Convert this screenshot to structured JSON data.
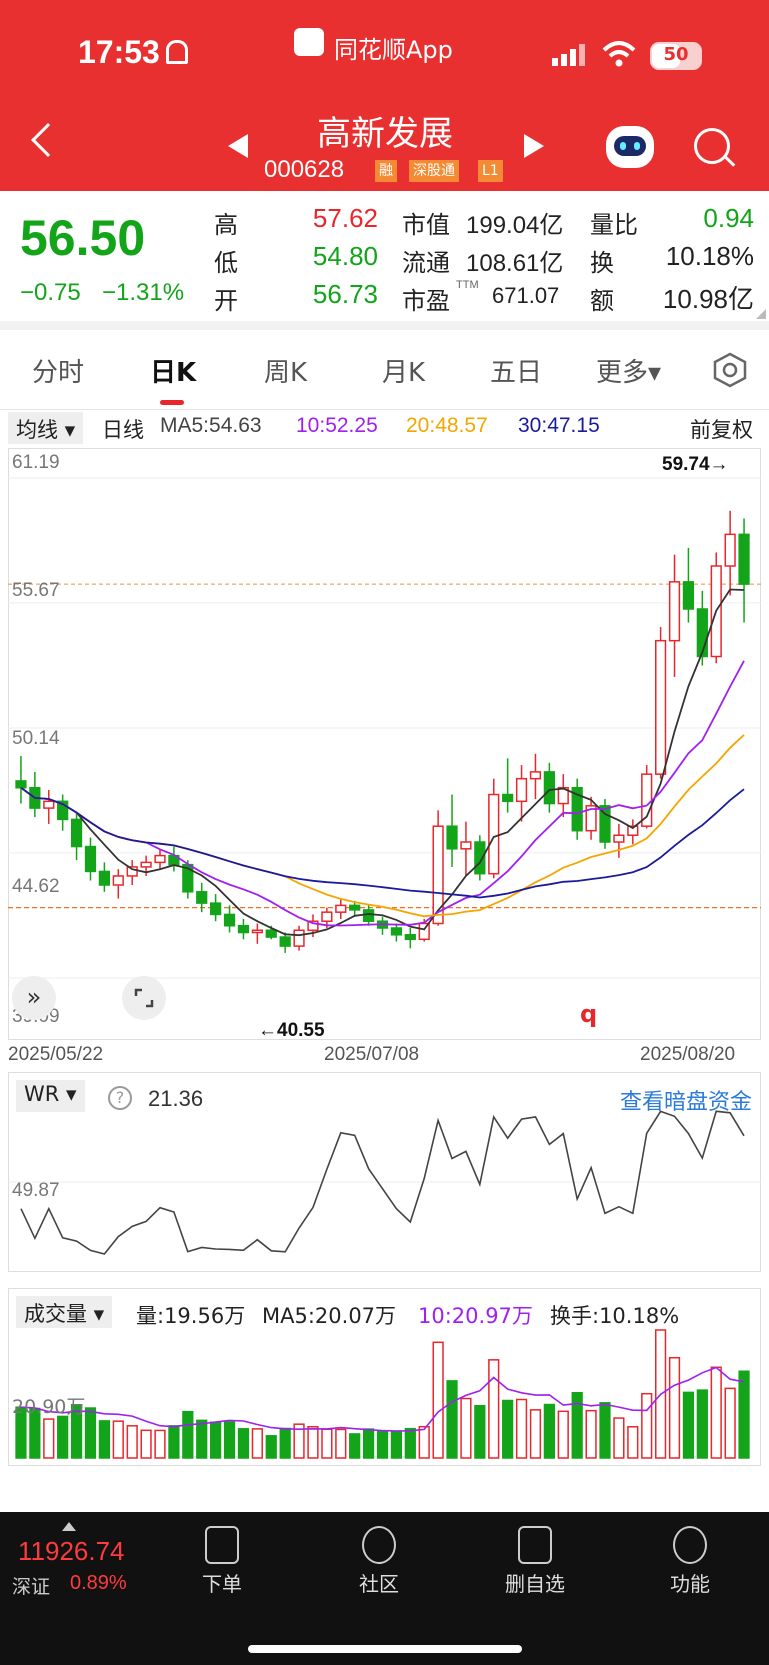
{
  "status_bar": {
    "time": "17:53",
    "app_name": "同花顺App",
    "battery": "50"
  },
  "header": {
    "title": "高新发展",
    "code": "000628",
    "badges": [
      "融",
      "深股通",
      "L1"
    ]
  },
  "quote": {
    "price": "56.50",
    "change": "−0.75",
    "change_pct": "−1.31%",
    "high_label": "高",
    "high": "57.62",
    "low_label": "低",
    "low": "54.80",
    "open_label": "开",
    "open": "56.73",
    "mcap_label": "市值",
    "mcap": "199.04亿",
    "float_label": "流通",
    "float": "108.61亿",
    "pe_label": "市盈",
    "pe_sup": "TTM",
    "pe": "671.07",
    "vr_label": "量比",
    "vr": "0.94",
    "turnover_label": "换",
    "turnover": "10.18%",
    "amount_label": "额",
    "amount": "10.98亿"
  },
  "tabs": [
    "分时",
    "日K",
    "周K",
    "月K",
    "五日",
    "更多▾"
  ],
  "active_tab": "日K",
  "ma_bar": {
    "selector": "均线 ▾",
    "period": "日线",
    "ma5": "MA5:54.63",
    "ma10": "10:52.25",
    "ma20": "20:48.57",
    "ma30": "30:47.15",
    "adjust": "前复权"
  },
  "kline": {
    "y_ticks": [
      "61.19",
      "55.67",
      "50.14",
      "44.62",
      "39.09"
    ],
    "max_label": "59.74→",
    "min_label": "←40.55",
    "x_dates": [
      "2025/05/22",
      "2025/07/08",
      "2025/08/20"
    ],
    "q_marker": "q"
  },
  "wr": {
    "selector": "WR ▾",
    "help": "?",
    "value": "21.36",
    "mid_tick": "49.87",
    "link": "查看暗盘资金"
  },
  "volume": {
    "selector": "成交量 ▾",
    "vol": "量:19.56万",
    "ma5": "MA5:20.07万",
    "ma10": "10:20.97万",
    "turnover": "换手:10.18%",
    "tick": "20.90万"
  },
  "bottom": {
    "index_value": "11926.74",
    "index_name": "深证",
    "index_pct": "0.89%",
    "nav": [
      "下单",
      "社区",
      "删自选",
      "功能"
    ]
  },
  "colors": {
    "up": "#e8262b",
    "down": "#13a41a",
    "ma5": "#333333",
    "ma10": "#a020f0",
    "ma20": "#f5a500",
    "ma30": "#1a1a9c",
    "header": "#e93030"
  },
  "chart_data": {
    "type": "candlestick",
    "date_range": [
      "2025/05/22",
      "2025/08/20"
    ],
    "y_axis": [
      39.09,
      61.19
    ],
    "highest": 59.74,
    "lowest": 40.55,
    "ohlc": [
      [
        47.8,
        48.9,
        46.8,
        47.5
      ],
      [
        47.5,
        48.2,
        46.2,
        46.6
      ],
      [
        46.6,
        47.4,
        45.9,
        46.9
      ],
      [
        46.9,
        47.2,
        45.6,
        46.1
      ],
      [
        46.1,
        46.4,
        44.3,
        44.9
      ],
      [
        44.9,
        45.3,
        43.4,
        43.8
      ],
      [
        43.8,
        44.2,
        42.9,
        43.2
      ],
      [
        43.2,
        43.9,
        42.6,
        43.6
      ],
      [
        43.6,
        44.3,
        43.2,
        44.0
      ],
      [
        44.0,
        44.5,
        43.6,
        44.2
      ],
      [
        44.2,
        44.8,
        43.9,
        44.5
      ],
      [
        44.5,
        44.9,
        43.8,
        44.1
      ],
      [
        44.1,
        44.3,
        42.6,
        42.9
      ],
      [
        42.9,
        43.3,
        42.0,
        42.4
      ],
      [
        42.4,
        42.8,
        41.6,
        41.9
      ],
      [
        41.9,
        42.3,
        41.1,
        41.4
      ],
      [
        41.4,
        41.7,
        40.8,
        41.1
      ],
      [
        41.1,
        41.5,
        40.6,
        41.2
      ],
      [
        41.2,
        41.4,
        40.8,
        40.9
      ],
      [
        40.9,
        41.1,
        40.2,
        40.5
      ],
      [
        40.5,
        41.4,
        40.3,
        41.2
      ],
      [
        41.2,
        41.9,
        40.9,
        41.6
      ],
      [
        41.6,
        42.2,
        41.3,
        42.0
      ],
      [
        42.0,
        42.6,
        41.7,
        42.3
      ],
      [
        42.3,
        42.5,
        41.8,
        42.1
      ],
      [
        42.1,
        42.3,
        41.4,
        41.6
      ],
      [
        41.6,
        41.8,
        41.0,
        41.3
      ],
      [
        41.3,
        41.5,
        40.7,
        41.0
      ],
      [
        41.0,
        41.3,
        40.4,
        40.8
      ],
      [
        40.8,
        41.7,
        40.7,
        41.5
      ],
      [
        41.5,
        46.5,
        41.4,
        45.8
      ],
      [
        45.8,
        47.2,
        44.0,
        44.8
      ],
      [
        44.8,
        46.0,
        43.6,
        45.1
      ],
      [
        45.1,
        45.4,
        43.4,
        43.7
      ],
      [
        43.7,
        47.9,
        43.5,
        47.2
      ],
      [
        47.2,
        48.8,
        46.4,
        46.9
      ],
      [
        46.9,
        48.5,
        46.0,
        47.9
      ],
      [
        47.9,
        49.0,
        47.0,
        48.2
      ],
      [
        48.2,
        48.6,
        46.4,
        46.8
      ],
      [
        46.8,
        48.1,
        46.2,
        47.5
      ],
      [
        47.5,
        47.9,
        45.2,
        45.6
      ],
      [
        45.6,
        47.1,
        45.2,
        46.7
      ],
      [
        46.7,
        47.0,
        44.8,
        45.1
      ],
      [
        45.1,
        45.9,
        44.4,
        45.4
      ],
      [
        45.4,
        46.1,
        45.0,
        45.8
      ],
      [
        45.8,
        48.5,
        45.7,
        48.1
      ],
      [
        48.1,
        54.6,
        47.9,
        54.0
      ],
      [
        54.0,
        57.8,
        52.4,
        56.6
      ],
      [
        56.6,
        58.1,
        54.8,
        55.4
      ],
      [
        55.4,
        56.2,
        52.9,
        53.3
      ],
      [
        53.3,
        57.9,
        53.0,
        57.3
      ],
      [
        57.3,
        59.74,
        56.0,
        58.7
      ],
      [
        58.7,
        59.4,
        54.8,
        56.5
      ]
    ],
    "ma_values": {
      "MA5": 54.63,
      "MA10": 52.25,
      "MA20": 48.57,
      "MA30": 47.15
    },
    "wr_value": 21.36,
    "volume_ma": {
      "MA5": "20.07万",
      "MA10": "20.97万"
    }
  }
}
